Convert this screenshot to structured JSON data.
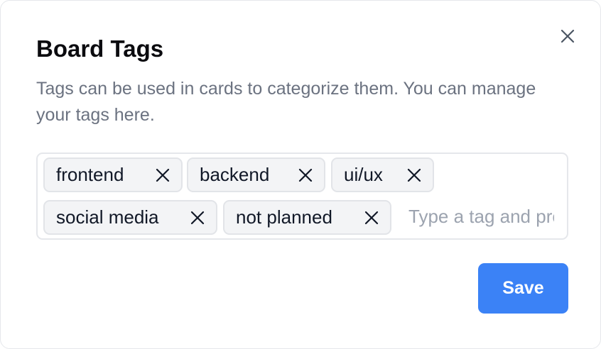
{
  "dialog": {
    "title": "Board Tags",
    "description": "Tags can be used in cards to categorize them. You can manage your tags here.",
    "close_icon": "close-icon"
  },
  "tags": {
    "items": [
      {
        "label": "frontend"
      },
      {
        "label": "backend"
      },
      {
        "label": "ui/ux"
      },
      {
        "label": "social media"
      },
      {
        "label": "not planned"
      }
    ],
    "remove_icon": "x-icon",
    "input_placeholder": "Type a tag and press Enter",
    "input_value": ""
  },
  "actions": {
    "save_label": "Save"
  },
  "colors": {
    "primary": "#3b82f6",
    "tag_background": "#f3f4f6",
    "muted_text": "#6b7280"
  }
}
